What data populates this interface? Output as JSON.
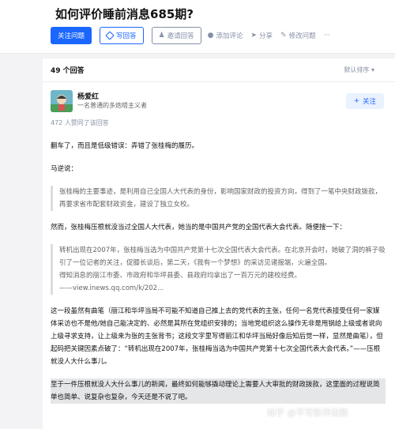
{
  "question": {
    "title": "如何评价睡前消息685期?"
  },
  "actions": {
    "follow_question": "关注问题",
    "write_answer": "写回答",
    "invite": "邀请回答",
    "add_comment": "添加评论",
    "share": "分享",
    "edit": "修改问题",
    "more": "···"
  },
  "answers": {
    "count": "49 个回答",
    "sort": "默认排序"
  },
  "answer": {
    "author_name": "杨爱红",
    "author_bio": "一名普通的多炮塔主义者",
    "follow": "关注",
    "votes": "472 人赞同了该回答",
    "paragraphs": {
      "p1": "翻车了，而且是低级错误：弄错了张桂梅的履历。",
      "p2": "马逆说：",
      "q1": "张桂梅的主要事迹，是利用自己全国人大代表的身份，影响国家财政的投资方向，得到了一笔中央财政拨款，再要求省市配套财政资金，建设了独立女校。",
      "p3": "然而，张桂梅压根就没当过全国人大代表，她当的是中国共产党的全国代表大会代表。随便搜一下：",
      "q2a": "转机出现在2007年，张桂梅当选为中国共产党第十七次全国代表大会代表。在北京开会时，她破了洞的裤子吸引了一位记者的关注，促膝长谈后，第二天，《我有一个梦想》的采访见诸报端，火遍全国。",
      "q2b": "得知消息的丽江市委、市政府和华坪县委、县政府均拿出了一百万元的建校经费。",
      "q2c": "——view.inews.qq.com/k/202...",
      "p4": "这一段虽然有曲笔（丽江和华坪当局不可能不知道自己推上去的党代表的主张，任何一名党代表接受任何一家媒体采访也不是他/她自己能决定的、必然是其所在党组织安排的；当地党组织这么操作无非是甩锅给上级或者说向上级寻求支持，让上级来为张的主张背书；这段文字里写得丽江和华坪当局好像后知后觉一样，显然是曲笔），但起码把关键因素点破了：“转机出现在2007年，张桂梅当选为中国共产党第十七次全国代表大会代表。”——压根就没人大什么事儿。",
      "p5": "至于一件压根就没人大什么事儿的新闻，最终如何能够撬动理论上需要人大审批的财政拨款，这里面的过程说简单也简单、说复杂也复杂，今天还是不说了吧。"
    }
  },
  "watermark": "知乎 @不写影评柒鹏"
}
